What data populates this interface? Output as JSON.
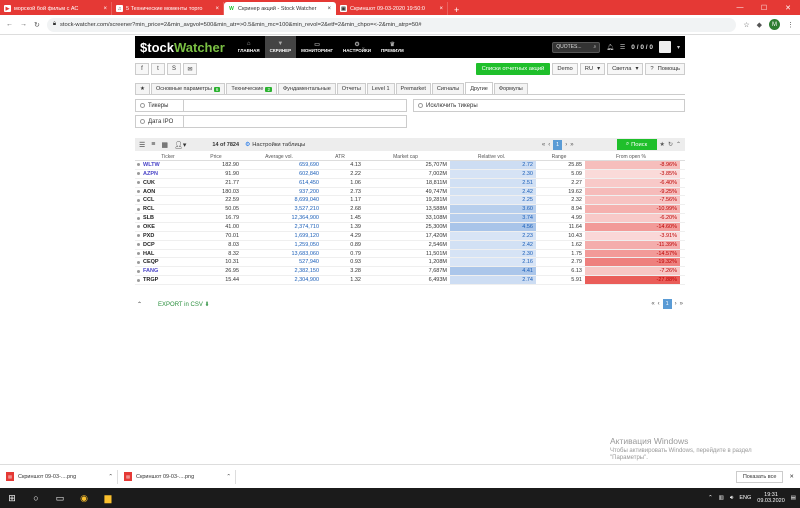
{
  "browser_tabs": [
    {
      "title": "морской бой фильм с АС",
      "icon": "video-icon",
      "active": false
    },
    {
      "title": "5 Технические моменты торго",
      "icon": "headphones-icon",
      "active": false
    },
    {
      "title": "Скринер акций - Stock Watcher",
      "icon": "W",
      "active": true
    },
    {
      "title": "Скриншот 09-03-2020 19:50:0",
      "icon": "image-icon",
      "active": false
    }
  ],
  "url": "stock-watcher.com/screener?min_price=2&min_avgvol=500&min_atr=>0.5&min_mc=100&min_revol=2&etf=2&min_chpo=<-2&min_atrp=50#",
  "profile_initial": "M",
  "nav": {
    "logo_prefix": "$",
    "logo_main": "tock",
    "logo_accent": "Watcher",
    "items": [
      {
        "label": "ГЛАВНАЯ",
        "icon": "home-icon"
      },
      {
        "label": "СКРИНЕР",
        "icon": "filter-icon",
        "active": true
      },
      {
        "label": "МОНИТОРИНГ",
        "icon": "monitor-icon"
      },
      {
        "label": "НАСТРОЙКИ",
        "icon": "gear-icon"
      },
      {
        "label": "ПРЕМИУМ",
        "icon": "crown-icon"
      }
    ],
    "quotes_placeholder": "QUOTES...",
    "counter": "0 / 0 / 0"
  },
  "secondary": {
    "reports_button": "Списки отчетных акций",
    "demo": "Demo",
    "lang": "RU",
    "theme": "Светла",
    "help": "Помощь"
  },
  "filter_tabs": [
    {
      "label": "Основные параметры",
      "badge": "6"
    },
    {
      "label": "Технические",
      "badge": "2"
    },
    {
      "label": "Фундаментальные"
    },
    {
      "label": "Отчеты"
    },
    {
      "label": "Level 1"
    },
    {
      "label": "Premarket"
    },
    {
      "label": "Сигналы"
    },
    {
      "label": "Другие",
      "active": true
    },
    {
      "label": "Формулы"
    }
  ],
  "filters": {
    "tickers": "Тикеры",
    "exclude": "Исключить тикеры",
    "ipo": "Дата IPO"
  },
  "toolbar": {
    "count": "14 of 7824",
    "settings": "Настройки таблицы",
    "page": "1",
    "search": "Поиск"
  },
  "columns": [
    "Ticker",
    "Price",
    "Average vol.",
    "ATR",
    "Market cap",
    "Relative vol.",
    "Range",
    "From open %"
  ],
  "rows": [
    {
      "ticker": "WLTW",
      "price": "182.90",
      "avgvol": "659,690",
      "atr": "4.13",
      "mcap": "25,707M",
      "relvol": "2.72",
      "range": "25.85",
      "fromopen": "-8.96%",
      "link": true,
      "rv": 0.3,
      "fo": 0.3
    },
    {
      "ticker": "AZPN",
      "price": "91.90",
      "avgvol": "602,840",
      "atr": "2.22",
      "mcap": "7,002M",
      "relvol": "2.30",
      "range": "5.09",
      "fromopen": "-3.85%",
      "link": true,
      "rv": 0.2,
      "fo": 0.1
    },
    {
      "ticker": "CUK",
      "price": "21.77",
      "avgvol": "614,450",
      "atr": "1.06",
      "mcap": "18,811M",
      "relvol": "2.51",
      "range": "2.27",
      "fromopen": "-6.40%",
      "link": false,
      "rv": 0.25,
      "fo": 0.22
    },
    {
      "ticker": "AON",
      "price": "180.03",
      "avgvol": "937,200",
      "atr": "2.73",
      "mcap": "49,747M",
      "relvol": "2.42",
      "range": "19.62",
      "fromopen": "-9.25%",
      "link": false,
      "rv": 0.23,
      "fo": 0.32
    },
    {
      "ticker": "CCL",
      "price": "22.59",
      "avgvol": "8,699,040",
      "atr": "1.17",
      "mcap": "19,281M",
      "relvol": "2.25",
      "range": "2.32",
      "fromopen": "-7.56%",
      "link": false,
      "rv": 0.18,
      "fo": 0.26
    },
    {
      "ticker": "RCL",
      "price": "50.05",
      "avgvol": "3,527,210",
      "atr": "2.68",
      "mcap": "13,588M",
      "relvol": "3.60",
      "range": "8.94",
      "fromopen": "-10.99%",
      "link": false,
      "rv": 0.55,
      "fo": 0.4
    },
    {
      "ticker": "SLB",
      "price": "16.79",
      "avgvol": "12,364,900",
      "atr": "1.45",
      "mcap": "33,108M",
      "relvol": "3.74",
      "range": "4.99",
      "fromopen": "-6.20%",
      "link": false,
      "rv": 0.58,
      "fo": 0.21
    },
    {
      "ticker": "OKE",
      "price": "41.00",
      "avgvol": "2,374,710",
      "atr": "1.39",
      "mcap": "25,300M",
      "relvol": "4.56",
      "range": "11.64",
      "fromopen": "-14.60%",
      "link": false,
      "rv": 0.75,
      "fo": 0.55
    },
    {
      "ticker": "PXD",
      "price": "70.01",
      "avgvol": "1,699,120",
      "atr": "4.29",
      "mcap": "17,420M",
      "relvol": "2.23",
      "range": "10.43",
      "fromopen": "-3.91%",
      "link": false,
      "rv": 0.18,
      "fo": 0.12
    },
    {
      "ticker": "DCP",
      "price": "8.03",
      "avgvol": "1,259,050",
      "atr": "0.89",
      "mcap": "2,546M",
      "relvol": "2.42",
      "range": "1.62",
      "fromopen": "-11.39%",
      "link": false,
      "rv": 0.23,
      "fo": 0.42
    },
    {
      "ticker": "HAL",
      "price": "8.32",
      "avgvol": "13,683,060",
      "atr": "0.79",
      "mcap": "11,501M",
      "relvol": "2.30",
      "range": "1.75",
      "fromopen": "-14.57%",
      "link": false,
      "rv": 0.2,
      "fo": 0.55
    },
    {
      "ticker": "CEQP",
      "price": "10.31",
      "avgvol": "527,940",
      "atr": "0.93",
      "mcap": "1,208M",
      "relvol": "2.16",
      "range": "2.79",
      "fromopen": "-19.32%",
      "link": false,
      "rv": 0.16,
      "fo": 0.75
    },
    {
      "ticker": "FANG",
      "price": "26.95",
      "avgvol": "2,382,150",
      "atr": "3.28",
      "mcap": "7,687M",
      "relvol": "4.41",
      "range": "6.13",
      "fromopen": "-7.26%",
      "link": true,
      "rv": 0.72,
      "fo": 0.25
    },
    {
      "ticker": "TRGP",
      "price": "15.44",
      "avgvol": "2,304,900",
      "atr": "1.32",
      "mcap": "6,493M",
      "relvol": "2.74",
      "range": "5.91",
      "fromopen": "-27.88%",
      "link": false,
      "rv": 0.3,
      "fo": 1.0
    }
  ],
  "export": "EXPORT in CSV",
  "watermark": {
    "title": "Активация Windows",
    "line1": "Чтобы активировать Windows, перейдите в раздел",
    "line2": "\"Параметры\"."
  },
  "downloads": [
    {
      "name": "Скриншот 09-03-....png"
    },
    {
      "name": "Скриншот 09-03-....png"
    }
  ],
  "show_all": "Показать все",
  "taskbar": {
    "lang": "ENG",
    "time": "19:31",
    "date": "09.03.2020"
  },
  "colors": {
    "chrome_red": "#e53935",
    "brand_green": "#1fbf2b",
    "relvol_blue": "#5a8fd6",
    "fromopen_red": "#e53935"
  }
}
